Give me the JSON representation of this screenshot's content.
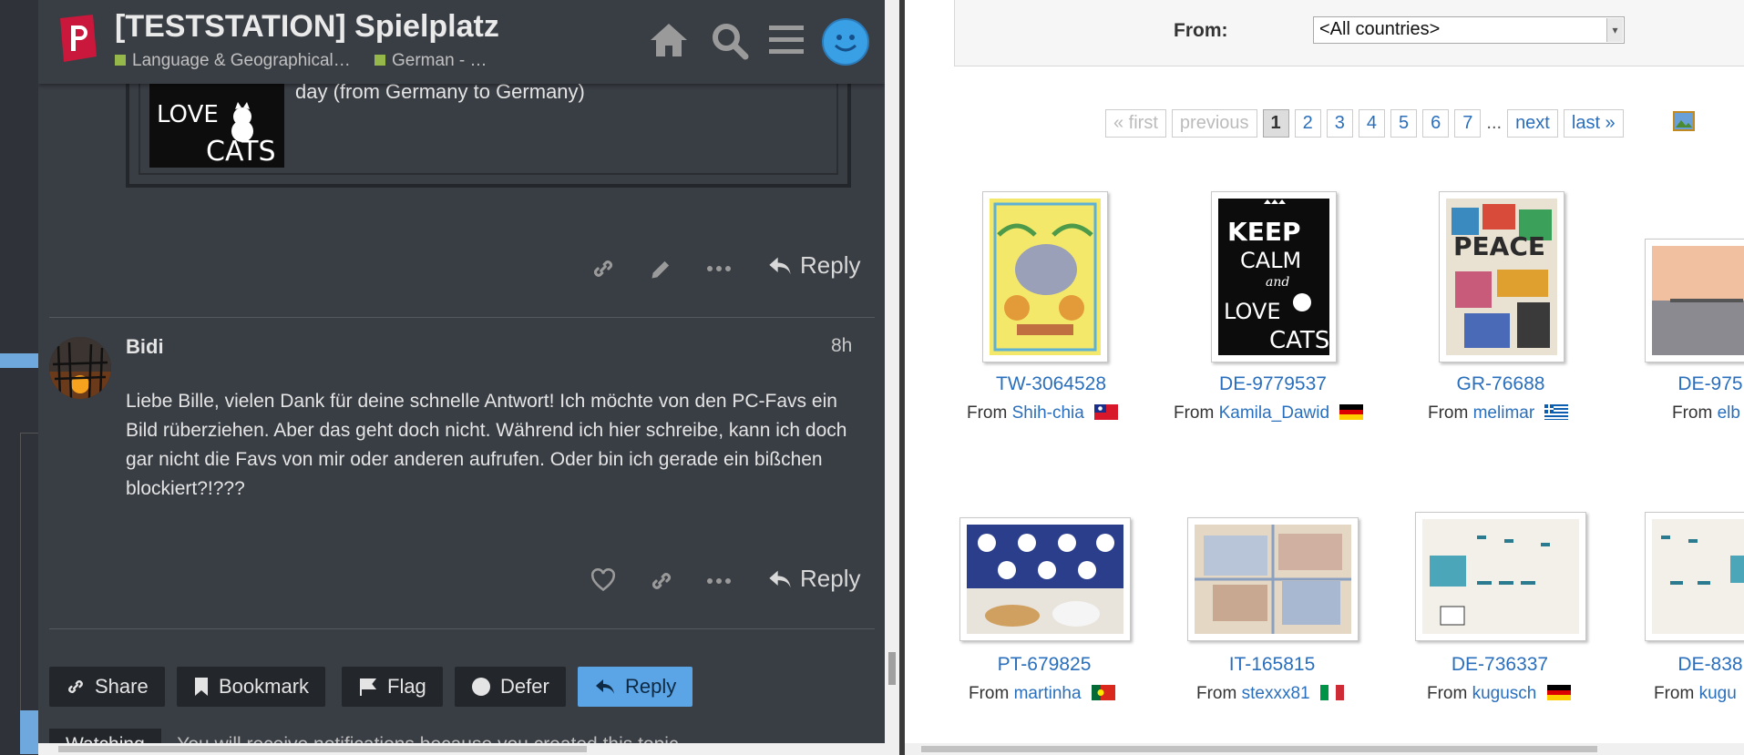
{
  "forum": {
    "site_title": "[TESTSTATION] Spielplatz",
    "breadcrumbs": [
      {
        "label": "Language & Geographical…",
        "color": "#96b84a"
      },
      {
        "label": "German - …",
        "color": "#96b84a"
      }
    ],
    "quoted_post": {
      "text": "day (from Germany to Germany)",
      "thumb_text_top": "LOVE",
      "thumb_text_bottom": "CATS"
    },
    "reply_label": "Reply",
    "post": {
      "author": "Bidi",
      "time": "8h",
      "body": "Liebe Bille, vielen Dank für deine schnelle Antwort! Ich möchte von den PC-Favs ein Bild rüberziehen. Aber das geht doch nicht. Während ich hier schreibe, kann ich doch gar nicht die Favs von mir oder anderen aufrufen. Oder bin ich gerade ein bißchen blockiert?!???"
    },
    "bottom_buttons": {
      "share": "Share",
      "bookmark": "Bookmark",
      "flag": "Flag",
      "defer": "Defer",
      "reply": "Reply"
    },
    "watching": {
      "button": "Watching",
      "text": "You will receive notifications because you created this topic."
    },
    "icons": [
      "home-icon",
      "search-icon",
      "hamburger-menu-icon",
      "user-avatar-icon",
      "link-icon",
      "pencil-icon",
      "more-icon",
      "reply-icon",
      "heart-icon",
      "bookmark-icon",
      "flag-icon"
    ]
  },
  "postcards": {
    "filter_label": "From:",
    "filter_value": "<All countries>",
    "pager": {
      "first": "« first",
      "previous": "previous",
      "pages": [
        "1",
        "2",
        "3",
        "4",
        "5",
        "6",
        "7"
      ],
      "current": "1",
      "dots": "...",
      "next": "next",
      "last": "last »"
    },
    "from_word": "From",
    "cards": [
      {
        "code": "TW-3064528",
        "user": "Shih-chia",
        "flag": "taiwan-flag"
      },
      {
        "code": "DE-9779537",
        "user": "Kamila_Dawid",
        "flag": "germany-flag"
      },
      {
        "code": "GR-76688",
        "user": "melimar",
        "flag": "greece-flag"
      },
      {
        "code": "DE-975",
        "user": "elb",
        "flag": "germany-flag"
      },
      {
        "code": "PT-679825",
        "user": "martinha",
        "flag": "portugal-flag"
      },
      {
        "code": "IT-165815",
        "user": "stexxx81",
        "flag": "italy-flag"
      },
      {
        "code": "DE-736337",
        "user": "kugusch",
        "flag": "germany-flag"
      },
      {
        "code": "DE-838",
        "user": "kugu",
        "flag": "germany-flag"
      }
    ],
    "card_thumb_texts": {
      "keep_calm": [
        "KEEP",
        "CALM",
        "and",
        "LOVE",
        "CATS"
      ],
      "peace": "PEACE"
    }
  }
}
